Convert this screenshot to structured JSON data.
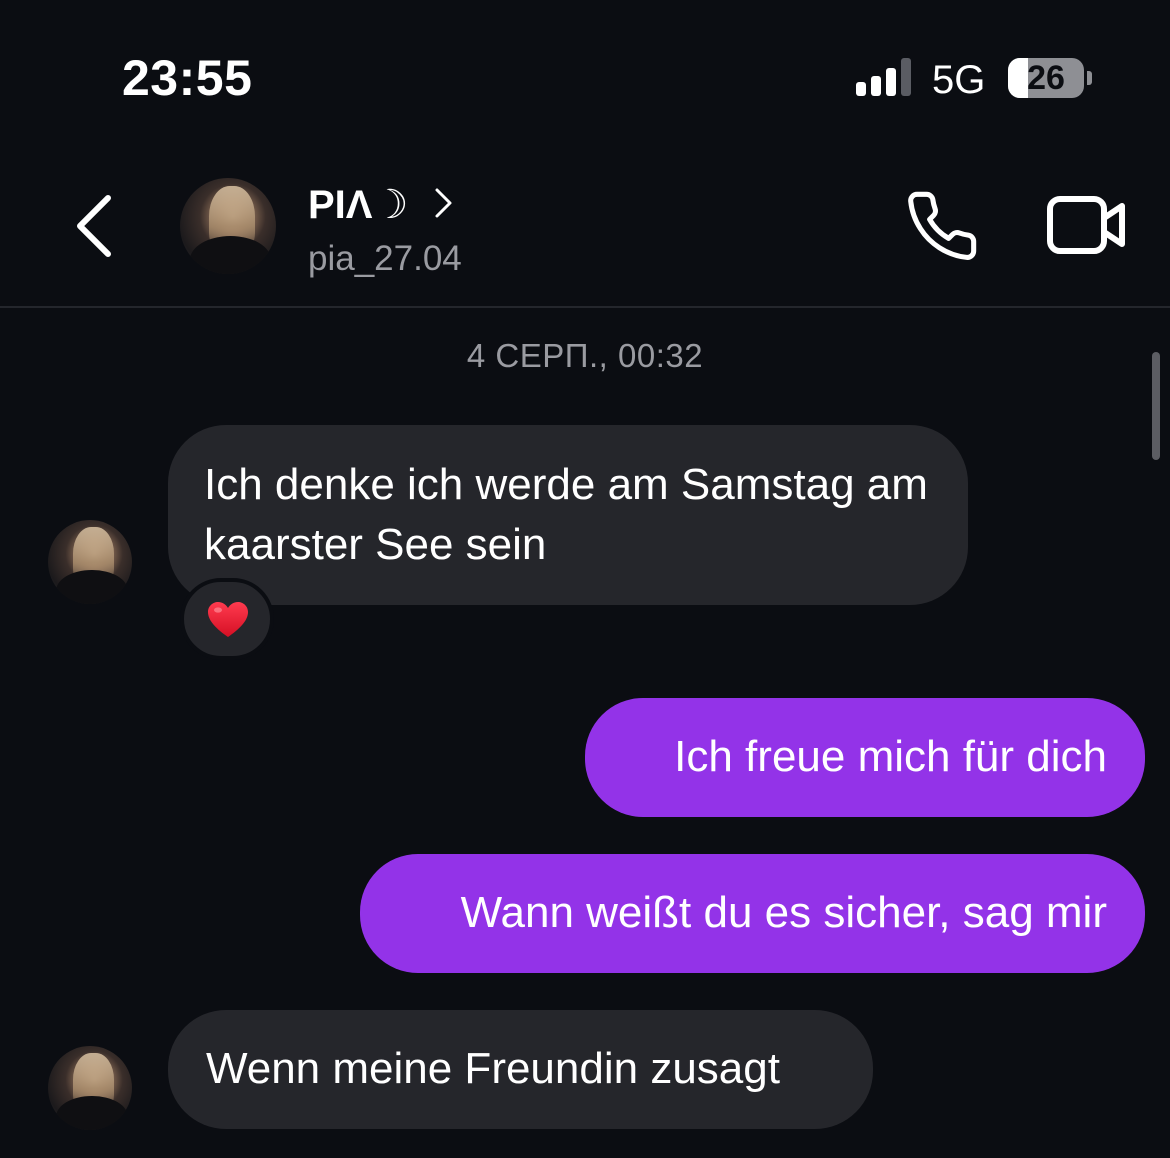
{
  "status_bar": {
    "time": "23:55",
    "network": "5G",
    "battery_level": "26",
    "battery_fraction": 0.26,
    "signal_bars_active": 3,
    "signal_bars_total": 4
  },
  "header": {
    "back_icon": "chevron-left-icon",
    "contact_name": "PIΛ☽",
    "chevron_icon": "chevron-right-icon",
    "username": "pia_27.04",
    "call_icon": "phone-icon",
    "video_icon": "video-camera-icon"
  },
  "conversation": {
    "timestamp": "4 СЕРП., 00:32",
    "messages": [
      {
        "direction": "incoming",
        "text": "Ich denke ich werde am Samstag am kaarster See sein",
        "reaction": "heart-icon"
      },
      {
        "direction": "outgoing",
        "text": "Ich freue mich für dich"
      },
      {
        "direction": "outgoing",
        "text": "Wann weißt du es sicher, sag mir"
      },
      {
        "direction": "incoming",
        "text": "Wenn meine Freundin zusagt"
      }
    ]
  },
  "colors": {
    "background": "#0b0d12",
    "incoming_bubble": "#25262b",
    "outgoing_bubble": "#9333e8",
    "secondary_text": "#9a9ba1",
    "reaction_heart": "#e8162d"
  }
}
